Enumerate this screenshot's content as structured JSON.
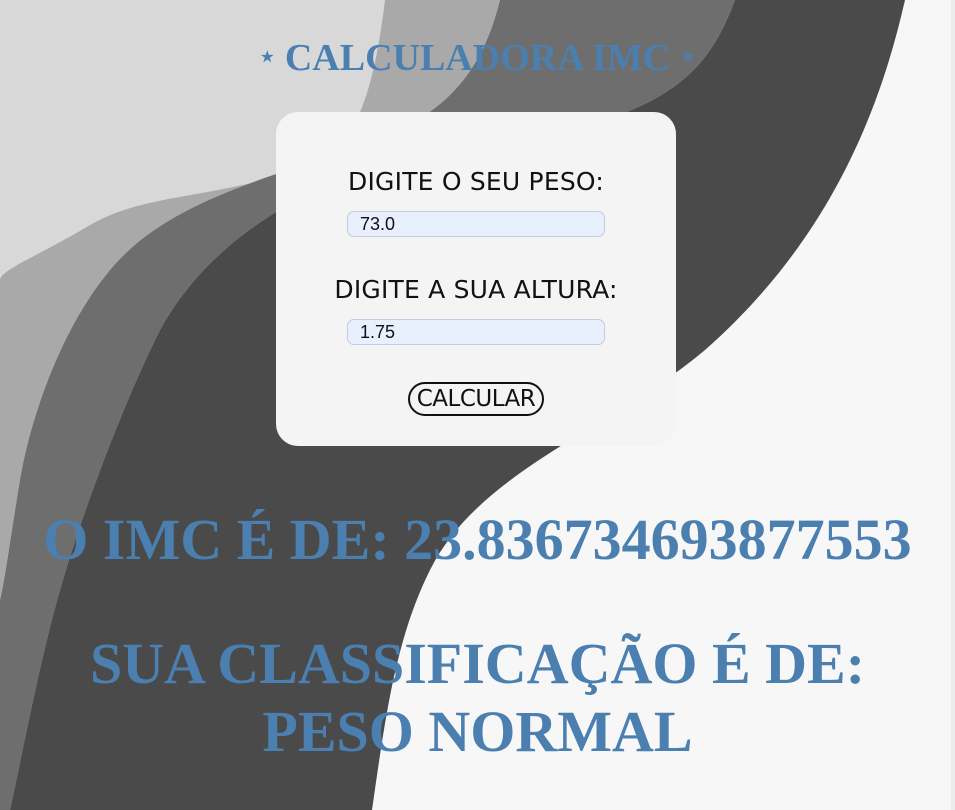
{
  "header": {
    "title": "CALCULADORA IMC",
    "star": "⋆"
  },
  "form": {
    "peso_label": "DIGITE O SEU PESO:",
    "peso_value": "73.0",
    "altura_label": "DIGITE A SUA ALTURA:",
    "altura_value": "1.75",
    "calcular_label": "CALCULAR"
  },
  "result": {
    "imc_text": "O IMC É DE: 23.836734693877553",
    "classification_line1": "SUA CLASSIFICAÇÃO É DE:",
    "classification_line2": "PESO NORMAL"
  },
  "colors": {
    "accent": "#4a7fb0",
    "page_background": "#f7f7f7",
    "card_background": "#f4f4f4",
    "input_background": "#e8f0fe",
    "wave_light": "#d8d8d8",
    "wave_mid": "#a9a9a9",
    "wave_dark": "#6e6e6e",
    "wave_darkest": "#4a4a4a"
  }
}
